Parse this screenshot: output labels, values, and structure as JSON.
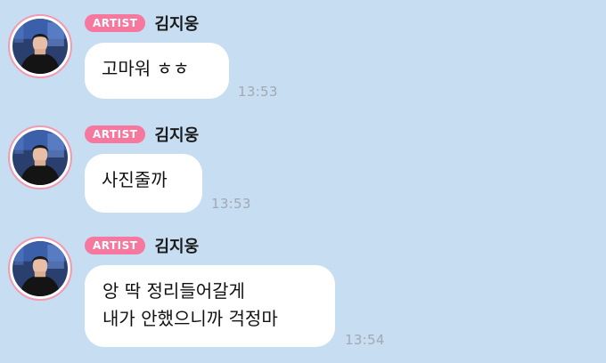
{
  "chat": {
    "messages": [
      {
        "badge": "ARTIST",
        "sender": "김지웅",
        "lines": [
          "고마워 ㅎㅎ"
        ],
        "time": "13:53"
      },
      {
        "badge": "ARTIST",
        "sender": "김지웅",
        "lines": [
          "사진줄까"
        ],
        "time": "13:53"
      },
      {
        "badge": "ARTIST",
        "sender": "김지웅",
        "lines": [
          "앙 딱 정리들어갈게",
          "내가 안했으니까 걱정마"
        ],
        "time": "13:54"
      }
    ]
  },
  "colors": {
    "background": "#c7ddf1",
    "badge": "#f7789f",
    "avatar_ring": "#f39ab3",
    "bubble": "#ffffff",
    "timestamp": "#a2a9b2"
  },
  "icons": {
    "avatar": "artist-profile-photo"
  }
}
